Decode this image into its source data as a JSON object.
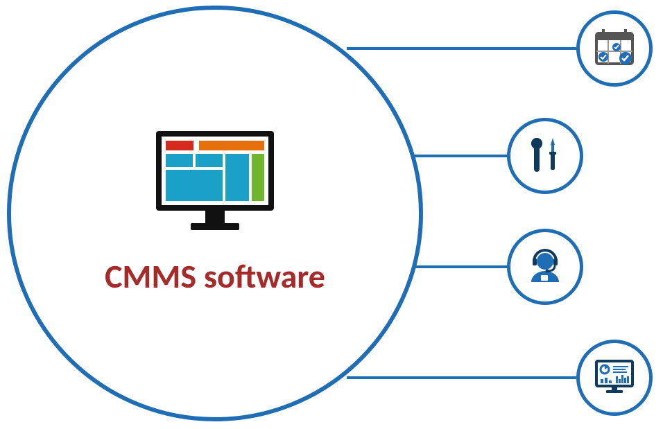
{
  "main_label": "CMMS software",
  "features": [
    {
      "name": "calendar-schedule",
      "icon": "calendar-check-icon"
    },
    {
      "name": "tools-maintenance",
      "icon": "wrench-screwdriver-icon"
    },
    {
      "name": "support-operator",
      "icon": "headset-person-icon"
    },
    {
      "name": "analytics-dashboard",
      "icon": "analytics-monitor-icon"
    }
  ],
  "colors": {
    "accent": "#1f6db5",
    "label": "#a52a2a",
    "dash_blue": "#1ba0c8",
    "dash_red": "#d52b1e",
    "dash_orange": "#e8700c",
    "dash_green": "#6fb52d",
    "dark_navy": "#103a5b"
  }
}
